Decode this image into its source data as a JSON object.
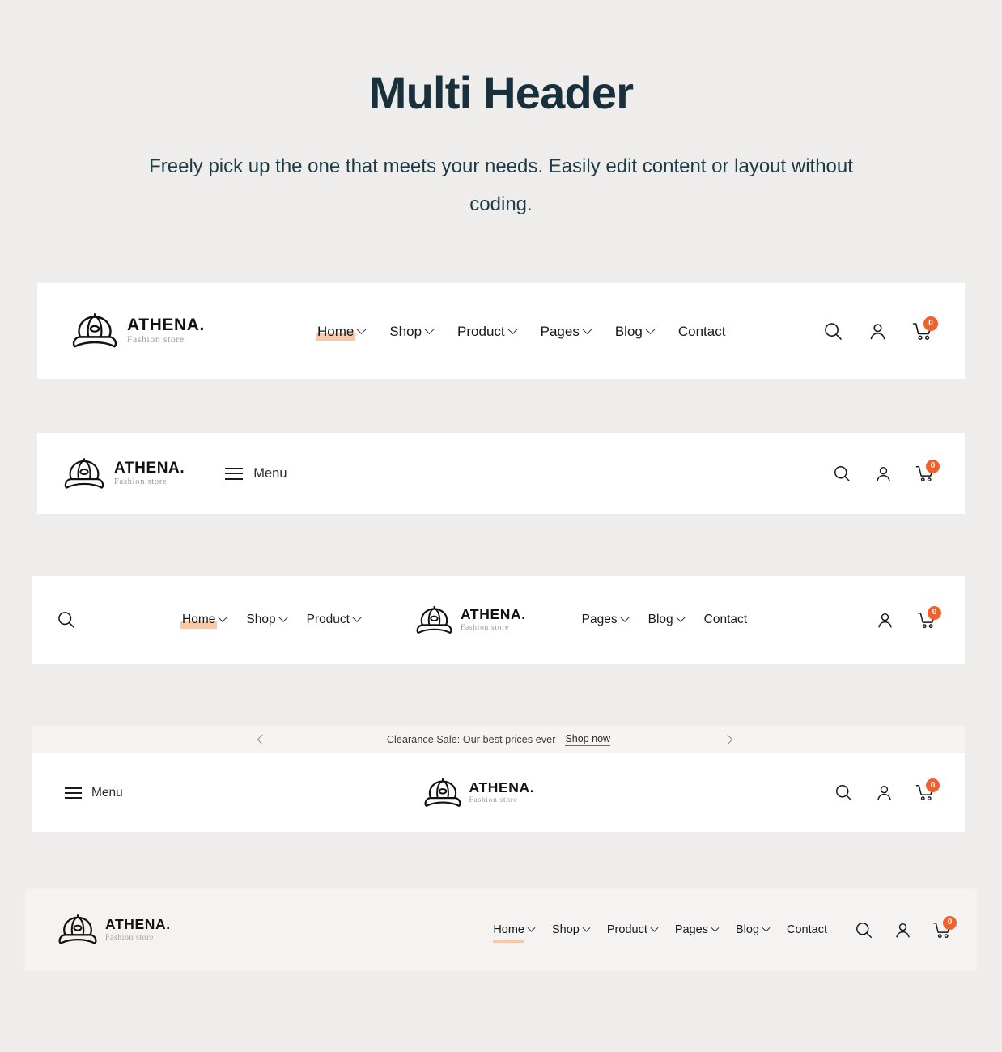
{
  "intro": {
    "title": "Multi Header",
    "subtitle": "Freely pick up the one that meets your needs. Easily edit content or layout without coding."
  },
  "brand": {
    "name": "ATHENA.",
    "tagline": "Fashion store",
    "logo_icon": "cap-logo-icon"
  },
  "colors": {
    "page_background": "#efedeb",
    "header_background": "#ffffff",
    "header5_background": "#f4f3f1",
    "announce_background": "#f5f4f3",
    "accent_peach": "#f7c9a8",
    "badge_orange": "#f2612c",
    "heading": "#17303b",
    "text": "#15181c"
  },
  "icons": {
    "search": "search-icon",
    "account": "user-icon",
    "cart": "cart-icon",
    "menu": "hamburger-icon",
    "caret": "chevron-down-icon",
    "prev": "chevron-left-icon",
    "next": "chevron-right-icon"
  },
  "cart": {
    "count": "0"
  },
  "menu_label": "Menu",
  "nav_full": [
    {
      "label": "Home",
      "has_caret": true,
      "active": true
    },
    {
      "label": "Shop",
      "has_caret": true,
      "active": false
    },
    {
      "label": "Product",
      "has_caret": true,
      "active": false
    },
    {
      "label": "Pages",
      "has_caret": true,
      "active": false
    },
    {
      "label": "Blog",
      "has_caret": true,
      "active": false
    },
    {
      "label": "Contact",
      "has_caret": false,
      "active": false
    }
  ],
  "nav_left": [
    {
      "label": "Home",
      "has_caret": true,
      "active": true
    },
    {
      "label": "Shop",
      "has_caret": true,
      "active": false
    },
    {
      "label": "Product",
      "has_caret": true,
      "active": false
    }
  ],
  "nav_right": [
    {
      "label": "Pages",
      "has_caret": true,
      "active": false
    },
    {
      "label": "Blog",
      "has_caret": true,
      "active": false
    },
    {
      "label": "Contact",
      "has_caret": false,
      "active": false
    }
  ],
  "announcement": {
    "text": "Clearance Sale: Our best prices ever",
    "link": "Shop now"
  },
  "headers": [
    {
      "id": "header-1",
      "style": "logo-left-nav-center-icons-right"
    },
    {
      "id": "header-2",
      "style": "logo-left-menu-toggle-icons-right"
    },
    {
      "id": "header-3",
      "style": "search-left-split-nav-centered-logo"
    },
    {
      "id": "header-4",
      "style": "announcement-bar-menu-centered-logo"
    },
    {
      "id": "header-5",
      "style": "logo-left-nav-right-tinted"
    }
  ]
}
